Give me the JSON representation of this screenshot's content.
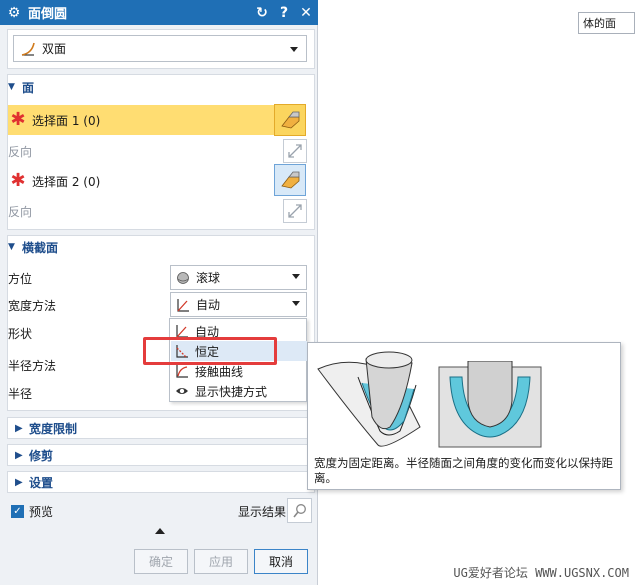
{
  "dialog": {
    "title": "面倒圆",
    "type_value": "双面"
  },
  "faces": {
    "header": "面",
    "select1": "选择面 1 (0)",
    "reverse1": "反向",
    "select2": "选择面 2 (0)",
    "reverse2": "反向"
  },
  "cross_section": {
    "header": "横截面",
    "orientation_label": "方位",
    "orientation_value": "滚球",
    "width_method_label": "宽度方法",
    "width_method_value": "自动",
    "shape_label": "形状",
    "radius_method_label": "半径方法",
    "radius_label": "半径"
  },
  "width_menu": {
    "items": [
      "自动",
      "恒定",
      "接触曲线",
      "显示快捷方式"
    ],
    "highlighted_index": 1
  },
  "tooltip": {
    "text": "宽度为固定距离。半径随面之间角度的变化而变化以保持距离。"
  },
  "collapsed_sections": [
    "宽度限制",
    "修剪",
    "设置"
  ],
  "footer": {
    "preview_label": "预览",
    "preview_checked": true,
    "show_result_label": "显示结果",
    "ok_label": "确定",
    "apply_label": "应用",
    "cancel_label": "取消"
  },
  "external": {
    "filter_text": "体的面"
  },
  "watermark": "UG爱好者论坛  WWW.UGSNX.COM",
  "colors": {
    "titlebar": "#1f6fb5",
    "active_selection": "#ffdd72",
    "highlight_rect": "#e43c3c",
    "fillet_blue": "#5fc8dc"
  }
}
